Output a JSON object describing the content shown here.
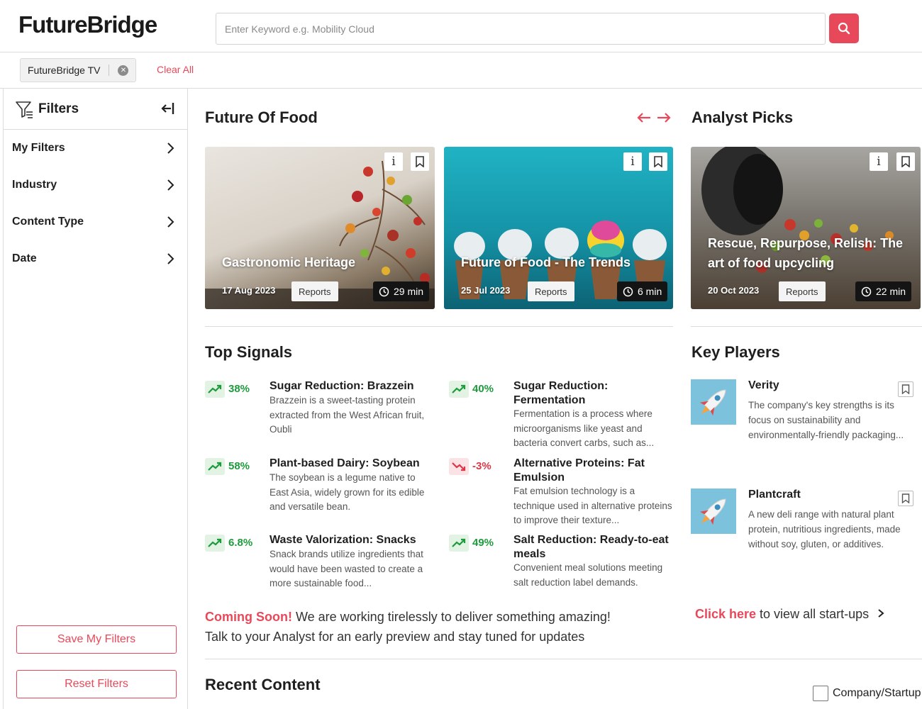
{
  "header": {
    "logo": "FutureBridge",
    "search_placeholder": "Enter Keyword e.g. Mobility Cloud"
  },
  "chips": {
    "active_chip": "FutureBridge TV",
    "clear_all": "Clear All"
  },
  "sidebar": {
    "title": "Filters",
    "items": [
      {
        "label": "My Filters"
      },
      {
        "label": "Industry"
      },
      {
        "label": "Content Type"
      },
      {
        "label": "Date"
      }
    ],
    "save_button": "Save My Filters",
    "reset_button": "Reset Filters"
  },
  "future_of_food": {
    "title": "Future Of Food",
    "cards": [
      {
        "title": "Gastronomic Heritage",
        "date": "17 Aug 2023",
        "tag": "Reports",
        "duration": "29 min"
      },
      {
        "title": "Future of Food - The Trends",
        "date": "25 Jul 2023",
        "tag": "Reports",
        "duration": "6 min"
      }
    ]
  },
  "analyst_picks": {
    "title": "Analyst Picks",
    "card": {
      "title_line1": "Rescue, Repurpose, Relish: The",
      "title_line2": "art of food upcycling",
      "date": "20 Oct 2023",
      "tag": "Reports",
      "duration": "22 min"
    }
  },
  "top_signals": {
    "title": "Top Signals",
    "items": [
      {
        "pct": "38%",
        "trend": "up",
        "title": "Sugar Reduction: Brazzein",
        "desc": "Brazzein is a sweet-tasting protein extracted from the West African fruit, Oubli"
      },
      {
        "pct": "40%",
        "trend": "up",
        "title": "Sugar Reduction: Fermentation",
        "desc": "Fermentation is a process where microorganisms like yeast and bacteria convert carbs, such as..."
      },
      {
        "pct": "58%",
        "trend": "up",
        "title": "Plant-based Dairy: Soybean",
        "desc": "The soybean is a legume native to East Asia, widely grown for its edible and versatile bean."
      },
      {
        "pct": "-3%",
        "trend": "down",
        "title": "Alternative Proteins: Fat Emulsion",
        "desc": "Fat emulsion technology is a technique used in alternative proteins to improve their texture..."
      },
      {
        "pct": "6.8%",
        "trend": "up",
        "title": "Waste Valorization: Snacks",
        "desc": "Snack brands utilize ingredients that would have been wasted to create a more sustainable food..."
      },
      {
        "pct": "49%",
        "trend": "up",
        "title": "Salt Reduction: Ready-to-eat meals",
        "desc": "Convenient meal solutions meeting salt reduction label demands."
      }
    ]
  },
  "key_players": {
    "title": "Key Players",
    "items": [
      {
        "name": "Verity",
        "desc": "The company's key strengths is its focus on sustainability and environmentally-friendly packaging..."
      },
      {
        "name": "Plantcraft",
        "desc": "A new deli range with natural plant protein, nutritious ingredients, made without soy, gluten, or additives."
      }
    ]
  },
  "coming_soon": {
    "highlight": "Coming Soon!",
    "line1_rest": " We are working tirelessly to deliver something amazing!",
    "line2": "Talk to your Analyst for an early preview and stay tuned for updates"
  },
  "startups_link": {
    "highlight": "Click here",
    "rest": " to view all start-ups"
  },
  "recent_content": {
    "title": "Recent Content",
    "checkbox_label": "Company/Startup"
  },
  "colors": {
    "accent": "#e8495a",
    "trend_up": "#1e9b3c",
    "trend_down": "#d9394a"
  }
}
